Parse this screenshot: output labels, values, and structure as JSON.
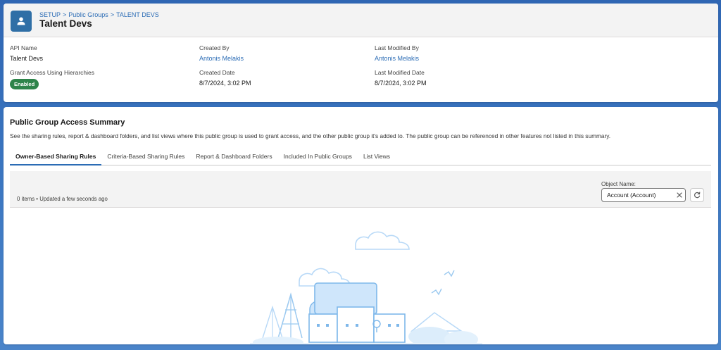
{
  "header": {
    "breadcrumb": [
      "SETUP",
      "Public Groups",
      "TALENT DEVS"
    ],
    "separator": ">",
    "title": "Talent Devs"
  },
  "details": {
    "api_name_label": "API Name",
    "api_name_value": "Talent Devs",
    "grant_access_label": "Grant Access Using Hierarchies",
    "grant_access_value": "Enabled",
    "created_by_label": "Created By",
    "created_by_value": "Antonis Melakis",
    "created_date_label": "Created Date",
    "created_date_value": "8/7/2024, 3:02 PM",
    "last_modified_by_label": "Last Modified By",
    "last_modified_by_value": "Antonis Melakis",
    "last_modified_date_label": "Last Modified Date",
    "last_modified_date_value": "8/7/2024, 3:02 PM"
  },
  "summary": {
    "title": "Public Group Access Summary",
    "description": "See the sharing rules, report & dashboard folders, and list views where this public group is used to grant access, and the other public group it's added to. The public group can be referenced in other features not listed in this summary.",
    "tabs": [
      {
        "label": "Owner-Based Sharing Rules",
        "active": true
      },
      {
        "label": "Criteria-Based Sharing Rules",
        "active": false
      },
      {
        "label": "Report & Dashboard Folders",
        "active": false
      },
      {
        "label": "Included In Public Groups",
        "active": false
      },
      {
        "label": "List Views",
        "active": false
      }
    ],
    "items_status": "0 items • Updated a few seconds ago",
    "object_name_label": "Object Name:",
    "object_name_value": "Account (Account)"
  },
  "colors": {
    "accent": "#2b6cb5",
    "badge_green": "#2e844a",
    "record_icon": "#2f6fa6"
  },
  "icons": {
    "record": "user-icon",
    "clear": "close-icon",
    "refresh": "refresh-icon"
  }
}
